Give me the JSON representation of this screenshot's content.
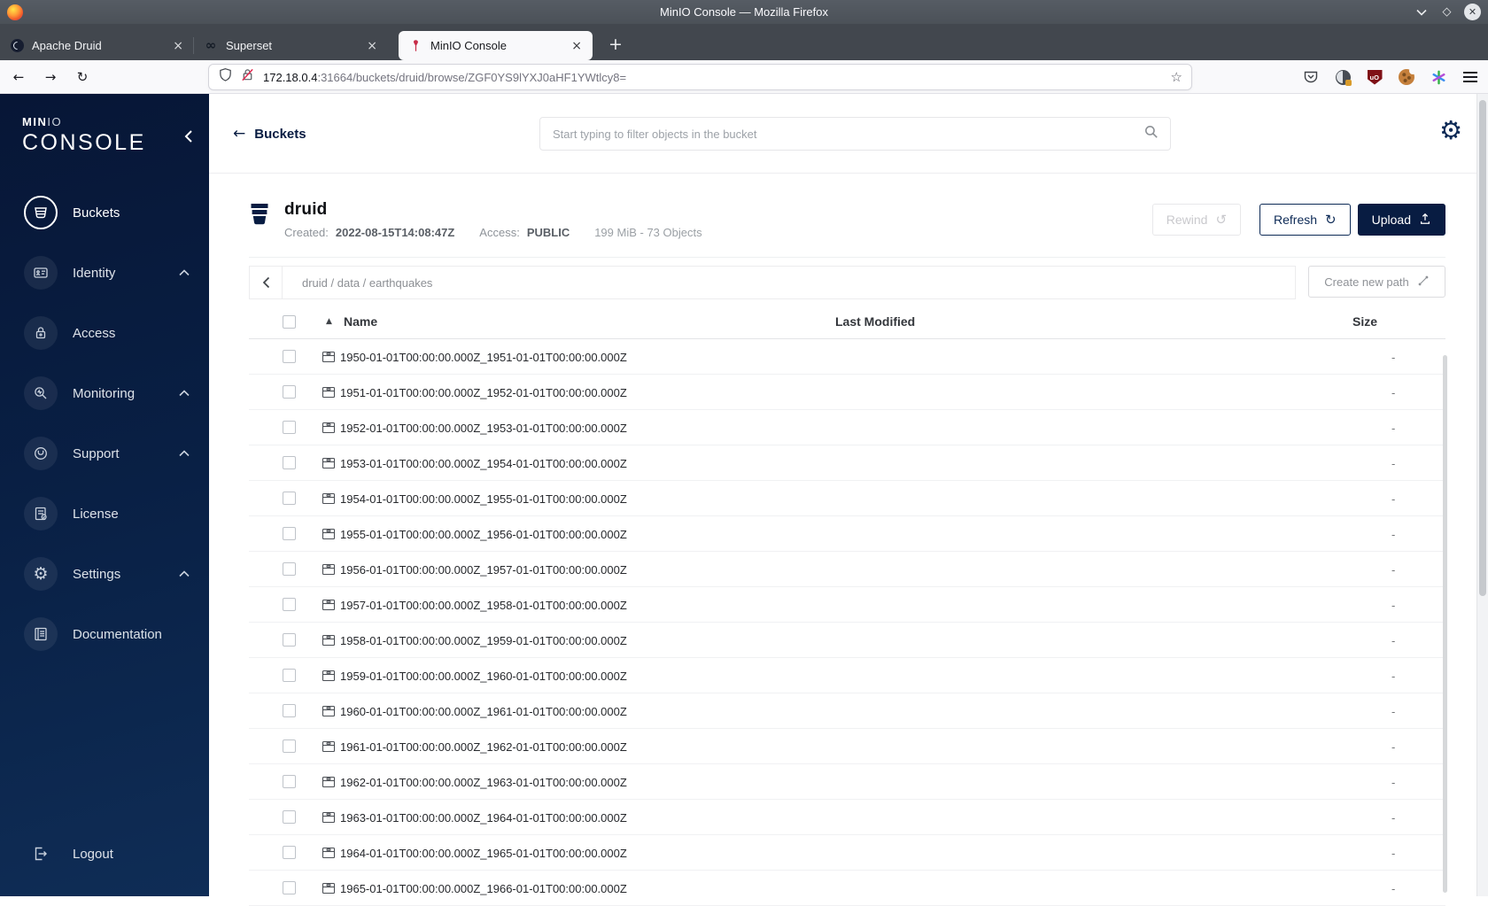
{
  "browser": {
    "window_title": "MinIO Console — Mozilla Firefox",
    "tabs": [
      {
        "title": "Apache Druid"
      },
      {
        "title": "Superset"
      },
      {
        "title": "MinIO Console"
      }
    ],
    "close_tab_glyph": "×",
    "new_tab_glyph": "+",
    "url": {
      "host": "172.18.0.4",
      "rest": ":31664/buckets/druid/browse/ZGF0YS9lYXJ0aHF1YWtlcy8="
    }
  },
  "sidebar": {
    "logo": {
      "min": "MIN",
      "io": "IO",
      "console": "CONSOLE"
    },
    "items": [
      {
        "label": "Buckets"
      },
      {
        "label": "Identity"
      },
      {
        "label": "Access"
      },
      {
        "label": "Monitoring"
      },
      {
        "label": "Support"
      },
      {
        "label": "License"
      },
      {
        "label": "Settings"
      },
      {
        "label": "Documentation"
      }
    ],
    "logout_label": "Logout"
  },
  "header": {
    "back_label": "Buckets",
    "back_arrow": "←",
    "search_placeholder": "Start typing to filter objects in the bucket"
  },
  "bucket": {
    "name": "druid",
    "created_label": "Created:",
    "created_value": "2022-08-15T14:08:47Z",
    "access_label": "Access:",
    "access_value": "PUBLIC",
    "stats": "199 MiB - 73 Objects",
    "rewind_label": "Rewind",
    "rewind_glyph": "↺",
    "refresh_label": "Refresh",
    "refresh_glyph": "↻",
    "upload_label": "Upload"
  },
  "browse": {
    "breadcrumb": "druid / data / earthquakes",
    "create_path_label": "Create new path"
  },
  "table": {
    "columns": {
      "name": "Name",
      "modified": "Last Modified",
      "size": "Size"
    },
    "sort_glyph": "▲",
    "rows": [
      {
        "name": "1950-01-01T00:00:00.000Z_1951-01-01T00:00:00.000Z",
        "size": "-"
      },
      {
        "name": "1951-01-01T00:00:00.000Z_1952-01-01T00:00:00.000Z",
        "size": "-"
      },
      {
        "name": "1952-01-01T00:00:00.000Z_1953-01-01T00:00:00.000Z",
        "size": "-"
      },
      {
        "name": "1953-01-01T00:00:00.000Z_1954-01-01T00:00:00.000Z",
        "size": "-"
      },
      {
        "name": "1954-01-01T00:00:00.000Z_1955-01-01T00:00:00.000Z",
        "size": "-"
      },
      {
        "name": "1955-01-01T00:00:00.000Z_1956-01-01T00:00:00.000Z",
        "size": "-"
      },
      {
        "name": "1956-01-01T00:00:00.000Z_1957-01-01T00:00:00.000Z",
        "size": "-"
      },
      {
        "name": "1957-01-01T00:00:00.000Z_1958-01-01T00:00:00.000Z",
        "size": "-"
      },
      {
        "name": "1958-01-01T00:00:00.000Z_1959-01-01T00:00:00.000Z",
        "size": "-"
      },
      {
        "name": "1959-01-01T00:00:00.000Z_1960-01-01T00:00:00.000Z",
        "size": "-"
      },
      {
        "name": "1960-01-01T00:00:00.000Z_1961-01-01T00:00:00.000Z",
        "size": "-"
      },
      {
        "name": "1961-01-01T00:00:00.000Z_1962-01-01T00:00:00.000Z",
        "size": "-"
      },
      {
        "name": "1962-01-01T00:00:00.000Z_1963-01-01T00:00:00.000Z",
        "size": "-"
      },
      {
        "name": "1963-01-01T00:00:00.000Z_1964-01-01T00:00:00.000Z",
        "size": "-"
      },
      {
        "name": "1964-01-01T00:00:00.000Z_1965-01-01T00:00:00.000Z",
        "size": "-"
      },
      {
        "name": "1965-01-01T00:00:00.000Z_1966-01-01T00:00:00.000Z",
        "size": "-"
      }
    ]
  }
}
